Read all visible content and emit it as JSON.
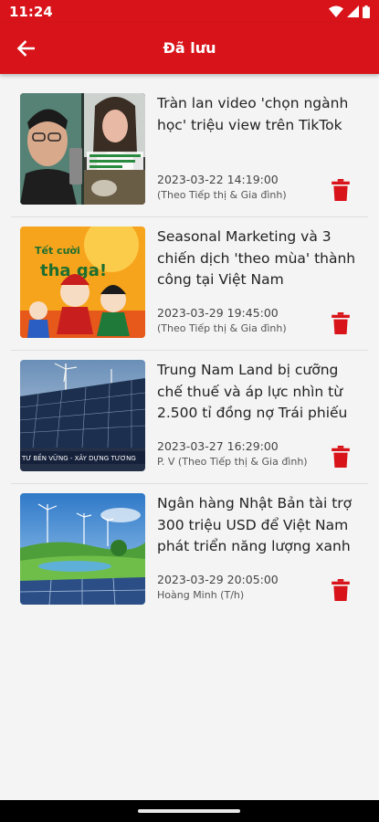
{
  "status_bar": {
    "time": "11:24"
  },
  "header": {
    "title": "Đã lưu",
    "back_icon": "arrow-left-icon"
  },
  "colors": {
    "brand_red": "#d8141a",
    "background": "#f4f4f4"
  },
  "articles": [
    {
      "title": "Tràn lan video 'chọn ngành học' triệu view trên TikTok",
      "date": "2023-03-22 14:19:00",
      "source": "(Theo Tiếp thị & Gia đình)",
      "action_icon": "trash-icon"
    },
    {
      "title": "Seasonal Marketing và 3 chiến dịch 'theo mùa' thành công tại Việt Nam",
      "date": "2023-03-29 19:45:00",
      "source": "(Theo Tiếp thị & Gia đình)",
      "action_icon": "trash-icon"
    },
    {
      "title": "Trung Nam Land bị cưỡng chế thuế và áp lực nhìn từ 2.500 tỉ đồng nợ Trái phiếu",
      "date": "2023-03-27 16:29:00",
      "source": "P. V (Theo Tiếp thị & Gia đình)",
      "action_icon": "trash-icon"
    },
    {
      "title": "Ngân hàng Nhật Bản tài trợ 300 triệu USD để Việt Nam phát triển năng lượng xanh",
      "date": "2023-03-29 20:05:00",
      "source": "Hoàng Minh (T/h)",
      "action_icon": "trash-icon"
    }
  ],
  "thumbnail_text": {
    "tet_banner_line1": "Tết cười",
    "tet_banner_line2": "tha ga!",
    "solar_caption": "TƯ BỀN VỮNG - XÂY DỰNG TƯƠNG"
  }
}
